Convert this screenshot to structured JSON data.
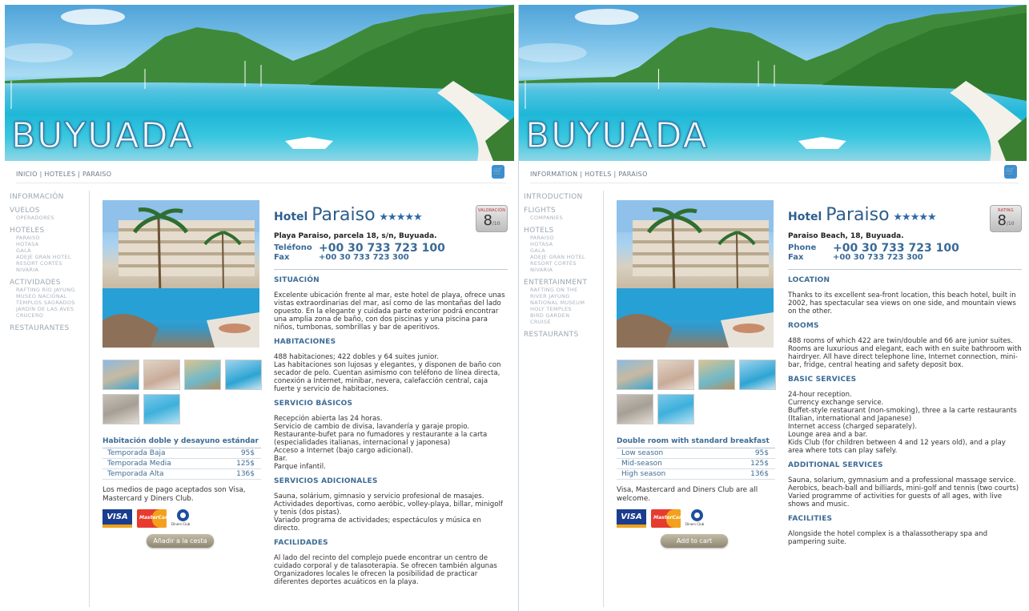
{
  "panels": [
    {
      "brand": "BUYUADA",
      "breadcrumb": "INICIO | HOTELES | PARAISO",
      "nav": [
        {
          "label": "INFORMACIÓN",
          "items": []
        },
        {
          "label": "VUELOS",
          "items": [
            "OPERADORES"
          ]
        },
        {
          "label": "HOTELES",
          "items": [
            "PARAISO",
            "HOTASA",
            "GALA",
            "ADEJE GRAN HOTEL",
            "RESORT CORTÉS",
            "NIVARIA"
          ]
        },
        {
          "label": "ACTIVIDADES",
          "items": [
            "RAFTING RÍO JAYUNG",
            "MUSEO NACIONAL",
            "TEMPLOS SAGRADOS",
            "JARDÍN DE LAS AVES",
            "CRUCERO"
          ]
        },
        {
          "label": "RESTAURANTES",
          "items": []
        }
      ],
      "hotel_prefix": "Hotel",
      "hotel_name": "Paraiso",
      "stars": "★★★★★",
      "rating_label": "VALORACIÓN",
      "rating_value": "8",
      "rating_of": "/10",
      "address": "Playa Paraiso, parcela 18, s/n, Buyuada.",
      "phone_label": "Teléfono",
      "phone": "+00 30 733 723 100",
      "fax_label": "Fax",
      "fax": "+00 30 733 723 300",
      "room_title": "Habitación doble y desayuno estándar",
      "seasons": [
        {
          "name": "Temporada Baja",
          "price": "95$"
        },
        {
          "name": "Temporada Media",
          "price": "125$"
        },
        {
          "name": "Temporada Alta",
          "price": "136$"
        }
      ],
      "payment_text": "Los medios de pago aceptados son Visa, Mastercard y Diners Club.",
      "cart_button": "Añadir a la cesta",
      "sections": [
        {
          "title": "SITUACIÓN",
          "lines": [
            "Excelente ubicación frente al mar, este hotel de playa, ofrece unas vistas extraordinarias del mar, así como de las montañas del lado opuesto. En la elegante y cuidada parte exterior podrá encontrar una amplia zona de baño, con dos piscinas y una piscina para niños, tumbonas, sombrillas y bar de aperitivos."
          ]
        },
        {
          "title": "HABITACIONES",
          "lines": [
            "488 habitaciones; 422 dobles y 64 suites junior.",
            "Las habitaciones son lujosas y elegantes, y disponen de baño con secador de pelo. Cuentan asimismo con teléfono de línea directa, conexión a Internet, minibar, nevera, calefacción central, caja fuerte y servicio de habitaciones."
          ]
        },
        {
          "title": "SERVICIO BÁSICOS",
          "lines": [
            "Recepción abierta las 24 horas.",
            "Servicio de cambio de divisa, lavandería y garaje propio.",
            "Restaurante-bufet para no fumadores y restaurante a la carta (especialidades italianas, internacional y japonesa)",
            "Acceso a Internet (bajo cargo adicional).",
            "Bar.",
            "Parque infantil."
          ]
        },
        {
          "title": "SERVICIOS ADICIONALES",
          "lines": [
            "Sauna, solárium, gimnasio y servicio profesional de masajes.",
            "Actividades deportivas, como aeróbic, volley-playa, billar, minigolf y tenis (dos pistas).",
            "Variado programa de actividades; espectáculos y música en directo."
          ]
        },
        {
          "title": "FACILIDADES",
          "lines": [
            "Al lado del recinto del complejo puede encontrar un centro de cuidado corporal y de talasoterapia. Se ofrecen también algunas Organizadores locales le ofrecen la posibilidad de practicar diferentes deportes acuáticos en la playa."
          ]
        }
      ]
    },
    {
      "brand": "BUYUADA",
      "breadcrumb": "INFORMATION | HOTELS | PARAISO",
      "nav": [
        {
          "label": "INTRODUCTION",
          "items": []
        },
        {
          "label": "FLIGHTS",
          "items": [
            "COMPANIES"
          ]
        },
        {
          "label": "HOTELS",
          "items": [
            "PARAISO",
            "HOTASA",
            "GALA",
            "ADEJE GRAN HOTEL",
            "RESORT CORTÉS",
            "NIVARIA"
          ]
        },
        {
          "label": "ENTERTAINMENT",
          "items": [
            "RAFTING ON THE",
            "RIVER JAYUNG",
            "NATIONAL MUSEUM",
            "HOLY TEMPLES",
            "BIRD GARDEN",
            "CRUISE"
          ]
        },
        {
          "label": "RESTAURANTS",
          "items": []
        }
      ],
      "hotel_prefix": "Hotel",
      "hotel_name": "Paraiso",
      "stars": "★★★★★",
      "rating_label": "RATING",
      "rating_value": "8",
      "rating_of": "/10",
      "address": "Paraiso Beach, 18, Buyuada.",
      "phone_label": "Phone",
      "phone": "+00 30 733 723 100",
      "fax_label": "Fax",
      "fax": "+00 30 733 723 300",
      "room_title": "Double room with standard breakfast",
      "seasons": [
        {
          "name": "Low season",
          "price": "95$"
        },
        {
          "name": "Mid-season",
          "price": "125$"
        },
        {
          "name": "High season",
          "price": "136$"
        }
      ],
      "payment_text": "Visa, Mastercard and Diners Club are all welcome.",
      "cart_button": "Add to cart",
      "sections": [
        {
          "title": "LOCATION",
          "lines": [
            "Thanks to its excellent sea-front location, this beach hotel, built in 2002, has spectacular sea views on one side, and mountain views on the other."
          ]
        },
        {
          "title": "ROOMS",
          "lines": [
            "488 rooms of which 422 are twin/double and 66 are junior suites.",
            "Rooms are luxurious and elegant, each with en suite bathroom with hairdryer. All have direct telephone line, Internet connection, mini-bar, fridge, central heating and safety deposit box."
          ]
        },
        {
          "title": "BASIC SERVICES",
          "lines": [
            "24-hour reception.",
            "Currency exchange service.",
            "Buffet-style restaurant (non-smoking), three a la carte restaurants (Italian, international and Japanese)",
            "Internet access (charged separately).",
            "Lounge area and a bar.",
            "Kids Club (for children between 4 and 12 years old), and a play area where tots can play safely."
          ]
        },
        {
          "title": "ADDITIONAL SERVICES",
          "lines": [
            "Sauna, solarium, gymnasium and a professional massage service.",
            "Aerobics, beach-ball and billiards, mini-golf and tennis (two courts)",
            "Varied programme of activities for guests of all ages, with live shows and music."
          ]
        },
        {
          "title": "FACILITIES",
          "lines": [
            "Alongside the hotel complex is a thalassotherapy spa and pampering suite."
          ]
        }
      ]
    }
  ],
  "colors": {
    "accent": "#3c6b95",
    "link": "#3a6a96",
    "nav": "#9aa7b3"
  }
}
